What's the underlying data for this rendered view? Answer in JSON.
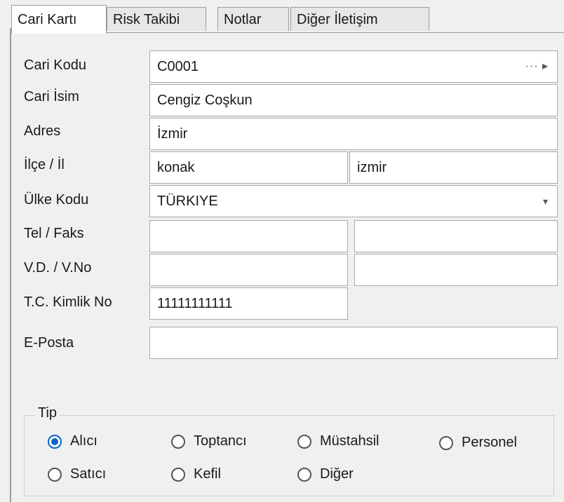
{
  "tabs": [
    "Cari Kartı",
    "Risk Takibi",
    "Notlar",
    "Diğer İletişim"
  ],
  "form": {
    "cari_kodu_label": "Cari Kodu",
    "cari_kodu_value": "C0001",
    "cari_kodu_suffix": "··· ▸",
    "cari_isim_label": "Cari İsim",
    "cari_isim_value": "Cengiz Coşkun",
    "adres_label": "Adres",
    "adres_value": "İzmir",
    "ilce_il_label": "İlçe / İl",
    "ilce_value": "konak",
    "il_value": "izmir",
    "ulke_kodu_label": "Ülke Kodu",
    "ulke_kodu_value": "TÜRKIYE",
    "ulke_kodu_arrow": "▾",
    "tel_faks_label": "Tel / Faks",
    "tel_value": "",
    "faks_value": "",
    "vd_vno_label": "V.D. / V.No",
    "vd_value": "",
    "vno_value": "",
    "tc_label": "T.C. Kimlik No",
    "tc_value": "11111111111",
    "eposta_label": "E-Posta",
    "eposta_value": ""
  },
  "tip": {
    "title": "Tip",
    "options": [
      {
        "label": "Alıcı",
        "selected": true
      },
      {
        "label": "Toptancı",
        "selected": false
      },
      {
        "label": "Müstahsil",
        "selected": false
      },
      {
        "label": "Personel",
        "selected": false
      },
      {
        "label": "Satıcı",
        "selected": false
      },
      {
        "label": "Kefil",
        "selected": false
      },
      {
        "label": "Diğer",
        "selected": false
      }
    ]
  },
  "colors": {
    "accent": "#0a63c9",
    "border": "#a9a9a9",
    "background": "#f0f0f0"
  }
}
